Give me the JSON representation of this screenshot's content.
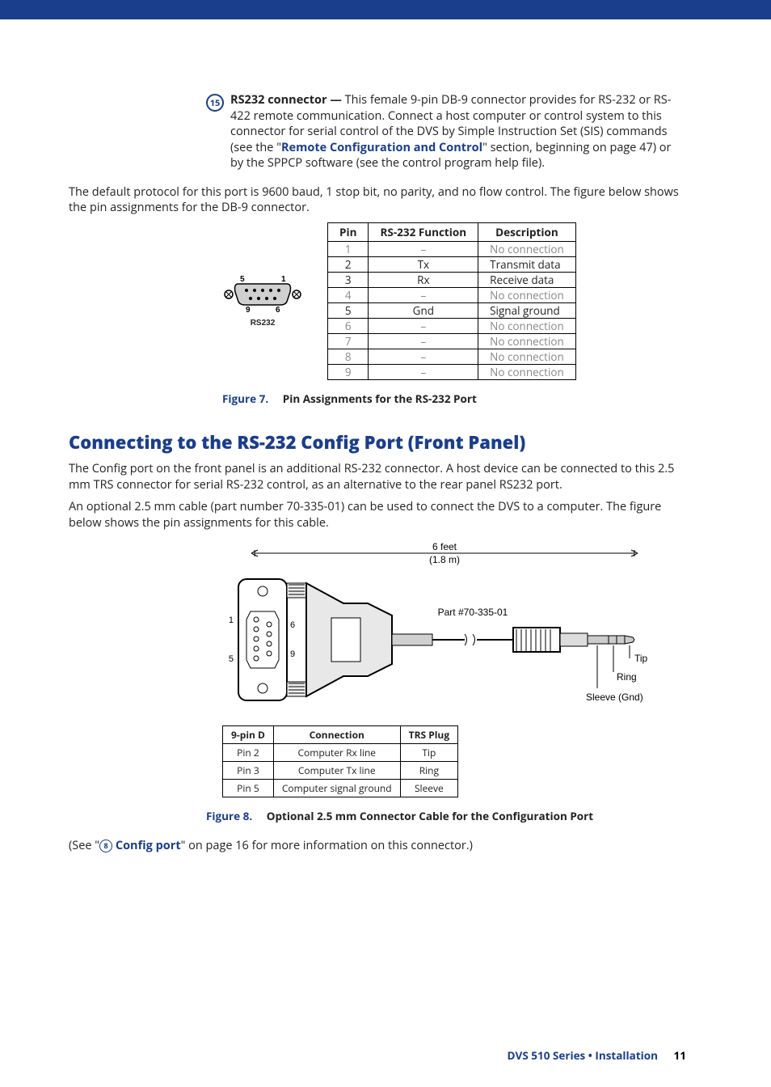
{
  "item15": {
    "badge": "15",
    "title": "RS232 connector — ",
    "text1a": "This female 9-pin DB-9 connector provides for RS-232 or RS-422 remote communication. Connect a host computer or control system to this connector for serial control of the DVS by Simple Instruction Set (SIS) commands (see the \"",
    "link1": "Remote Configuration and Control",
    "text1b": "\" section, beginning on page 47) or by the SPPCP software (see the control program help file).",
    "text2": "The default protocol for this port is 9600 baud, 1 stop bit, no parity, and no flow control. The figure below shows the pin assignments for the DB-9 connector."
  },
  "pinTable": {
    "headers": [
      "Pin",
      "RS-232 Function",
      "Description"
    ],
    "rows": [
      {
        "pin": "1",
        "func": "–",
        "desc": "No connection",
        "nc": true
      },
      {
        "pin": "2",
        "func": "Tx",
        "desc": "Transmit data",
        "nc": false
      },
      {
        "pin": "3",
        "func": "Rx",
        "desc": "Receive data",
        "nc": false
      },
      {
        "pin": "4",
        "func": "–",
        "desc": "No connection",
        "nc": true
      },
      {
        "pin": "5",
        "func": "Gnd",
        "desc": "Signal ground",
        "nc": false
      },
      {
        "pin": "6",
        "func": "–",
        "desc": "No connection",
        "nc": true
      },
      {
        "pin": "7",
        "func": "–",
        "desc": "No connection",
        "nc": true
      },
      {
        "pin": "8",
        "func": "–",
        "desc": "No connection",
        "nc": true
      },
      {
        "pin": "9",
        "func": "–",
        "desc": "No connection",
        "nc": true
      }
    ]
  },
  "db9": {
    "label": "RS232",
    "p5": "5",
    "p1": "1",
    "p9": "9",
    "p6": "6"
  },
  "fig7": {
    "num": "Figure 7.",
    "title": "Pin Assignments for the RS-232 Port"
  },
  "heading": "Connecting to the RS-232 Config Port (Front Panel)",
  "sec2": {
    "p1": "The Config port on the front panel is an additional RS-232 connector. A host device can be connected to this 2.5 mm TRS connector for serial RS-232 control, as an alternative to the rear panel RS232 port.",
    "p2": "An optional 2.5 mm cable (part number 70-335-01) can be used to connect the DVS to a computer. The figure below shows the pin assignments for this cable."
  },
  "diagram": {
    "length": "6 feet",
    "lengthm": "(1.8 m)",
    "part": "Part #70-335-01",
    "tip": "Tip",
    "ring": "Ring",
    "sleeve": "Sleeve (Gnd)",
    "d1": "1",
    "d5": "5",
    "d6": "6",
    "d9": "9"
  },
  "connTable": {
    "headers": [
      "9-pin D",
      "Connection",
      "TRS Plug"
    ],
    "rows": [
      {
        "d": "Pin 2",
        "c": "Computer Rx line",
        "t": "Tip"
      },
      {
        "d": "Pin 3",
        "c": "Computer Tx line",
        "t": "Ring"
      },
      {
        "d": "Pin 5",
        "c": "Computer signal ground",
        "t": "Sleeve"
      }
    ]
  },
  "fig8": {
    "num": "Figure 8.",
    "title": "Optional 2.5 mm Connector Cable for the Configuration Port"
  },
  "seeRef": {
    "pre": "(See \"",
    "badge": "8",
    "link": "Config port",
    "post": "\" on page 16 for more information on this connector.)"
  },
  "footer": {
    "text": "DVS 510 Series • Installation",
    "page": "11"
  }
}
